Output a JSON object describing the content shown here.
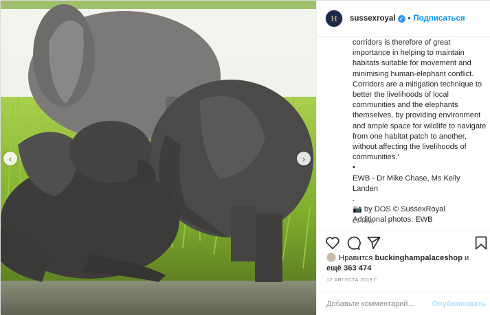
{
  "header": {
    "avatar_letter": "H",
    "username": "sussexroyal",
    "separator": "•",
    "follow_label": "Подписаться"
  },
  "caption": {
    "text": "corridors is therefore of great importance in helping to maintain habitats suitable for movement and minimising human-elephant conflict. Corridors are a mitigation technique to better the livelihoods of local communities and the elephants themselves, by providing environment and ample space for wildlife to navigate from one habitat patch to another, without affecting the livelihoods of communities.'",
    "bullet": "•",
    "credit_line1": "EWB - Dr Mike Chase, Ms Kelly Landen",
    "dot": ".",
    "credit_line2": "📷 by DOS © SussexRoyal",
    "credit_line3": "Additional photos: EWB"
  },
  "time_ago": "25 нед.",
  "likes": {
    "prefix": "Нравится",
    "user": "buckinghampalaceshop",
    "conj": "и",
    "more": "ещё 363 474"
  },
  "date": "12 АВГУСТА 2019 Г.",
  "comment": {
    "placeholder": "Добавьте комментарий...",
    "publish_label": "Опубликовать"
  },
  "media": {
    "prev_arrow": "‹",
    "next_arrow": "›"
  },
  "colors": {
    "accent": "#0095f6",
    "verified": "#3897f0",
    "muted": "#8e8e8e"
  }
}
